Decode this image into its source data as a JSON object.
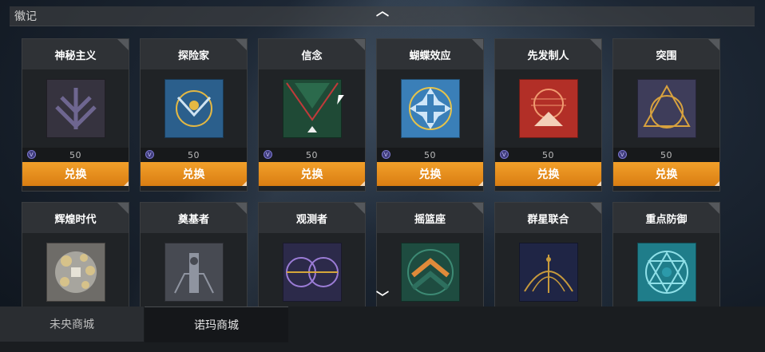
{
  "header": {
    "title": "徽记"
  },
  "colors": {
    "exchange": "#e8901c",
    "currency": "#6f6ad0"
  },
  "cards": [
    {
      "name": "神秘主义",
      "price": "50",
      "button": "兑换",
      "emblem_bg": "#36333f",
      "emblem_fg": "#6e6690",
      "motif": "chevron"
    },
    {
      "name": "探险家",
      "price": "50",
      "button": "兑换",
      "emblem_bg": "#2b5f8c",
      "emblem_fg": "#e4b843",
      "motif": "circle"
    },
    {
      "name": "信念",
      "price": "50",
      "button": "兑换",
      "emblem_bg": "#1f4a36",
      "emblem_fg": "#c03a3a",
      "motif": "diamond"
    },
    {
      "name": "蝴蝶效应",
      "price": "50",
      "button": "兑换",
      "emblem_bg": "#3a7fb8",
      "emblem_fg": "#e6c34a",
      "motif": "cross"
    },
    {
      "name": "先发制人",
      "price": "50",
      "button": "兑换",
      "emblem_bg": "#b22f27",
      "emblem_fg": "#f09a70",
      "motif": "sun"
    },
    {
      "name": "突围",
      "price": "50",
      "button": "兑换",
      "emblem_bg": "#3e3d5a",
      "emblem_fg": "#d8a23e",
      "motif": "triangle"
    },
    {
      "name": "辉煌时代",
      "price": "",
      "button": "",
      "emblem_bg": "#6e6c68",
      "emblem_fg": "#d6c28a",
      "motif": "dots"
    },
    {
      "name": "奠基者",
      "price": "",
      "button": "",
      "emblem_bg": "#474a52",
      "emblem_fg": "#8f94a0",
      "motif": "tower"
    },
    {
      "name": "观测者",
      "price": "",
      "button": "",
      "emblem_bg": "#2c2a4a",
      "emblem_fg": "#9b7cd6",
      "motif": "eye"
    },
    {
      "name": "摇篮座",
      "price": "",
      "button": "",
      "emblem_bg": "#1e4c40",
      "emblem_fg": "#e08a3a",
      "motif": "chevron-up"
    },
    {
      "name": "群星联合",
      "price": "",
      "button": "",
      "emblem_bg": "#1f2545",
      "emblem_fg": "#c79a3c",
      "motif": "stars"
    },
    {
      "name": "重点防御",
      "price": "",
      "button": "",
      "emblem_bg": "#1f7d8a",
      "emblem_fg": "#8fe0e8",
      "motif": "hexagram"
    }
  ],
  "tabs": [
    {
      "label": "未央商城"
    },
    {
      "label": "诺玛商城"
    }
  ]
}
